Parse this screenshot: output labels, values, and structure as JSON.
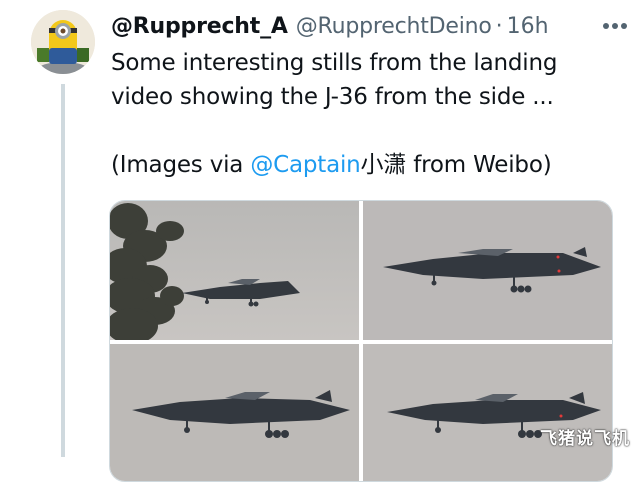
{
  "tweet": {
    "display_name": "@Rupprecht_A",
    "handle": "@RupprechtDeino",
    "separator": "·",
    "time": "16h",
    "more_label": "···",
    "text_line1": "Some interesting stills from the landing",
    "text_line2": "video showing the J-36 from the side ...",
    "credit_prefix": "(Images via ",
    "credit_mention": "@Captain",
    "credit_suffix": "小潇 from Weibo)"
  },
  "watermark": "飞猪说飞机",
  "colors": {
    "accent": "#1d9bf0",
    "secondary_text": "#536471",
    "thread_line": "#cfd9de"
  }
}
